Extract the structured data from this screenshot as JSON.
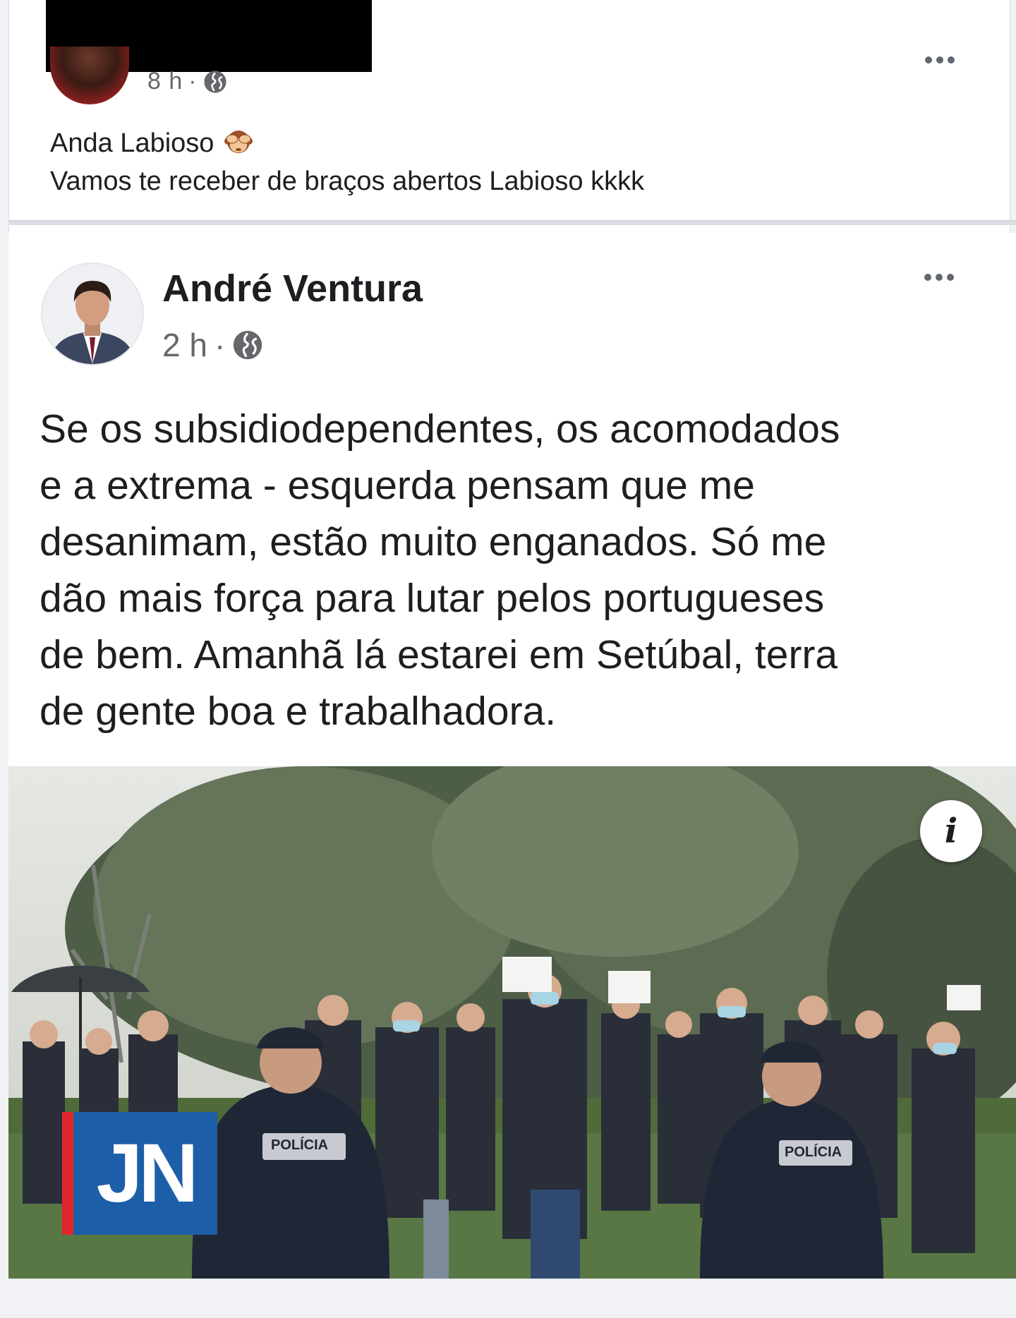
{
  "outer_post": {
    "meta_time": "8 h",
    "meta_separator": "·",
    "privacy_icon": "globe-icon",
    "more_icon": "more-options-icon",
    "text_line_1": "Anda Labioso",
    "emoji_icon": "see-no-evil-monkey-icon",
    "text_line_2": "Vamos te receber de braços abertos Labioso kkkk"
  },
  "shared_post": {
    "author_name": "André Ventura",
    "meta_time": "2 h",
    "meta_separator": "·",
    "privacy_icon": "globe-icon",
    "more_icon": "more-options-icon",
    "body_lines": [
      "Se os subsidiodependentes, os acomodados",
      "e a extrema - esquerda pensam que me",
      "desanimam, estão muito enganados. Só me",
      "dão mais força para lutar pelos portugueses",
      "de bem. Amanhã lá estarei em Setúbal, terra",
      "de gente boa e trabalhadora."
    ],
    "photo": {
      "info_icon_label": "i",
      "watermark": "JN",
      "vest_label": "POLÍCIA"
    }
  },
  "colors": {
    "page_bg": "#f0f2f5",
    "card_bg": "#ffffff",
    "text_primary": "#1c1e21",
    "text_secondary": "#65676b",
    "jn_blue": "#1d5ea8",
    "jn_red": "#e0262b"
  }
}
